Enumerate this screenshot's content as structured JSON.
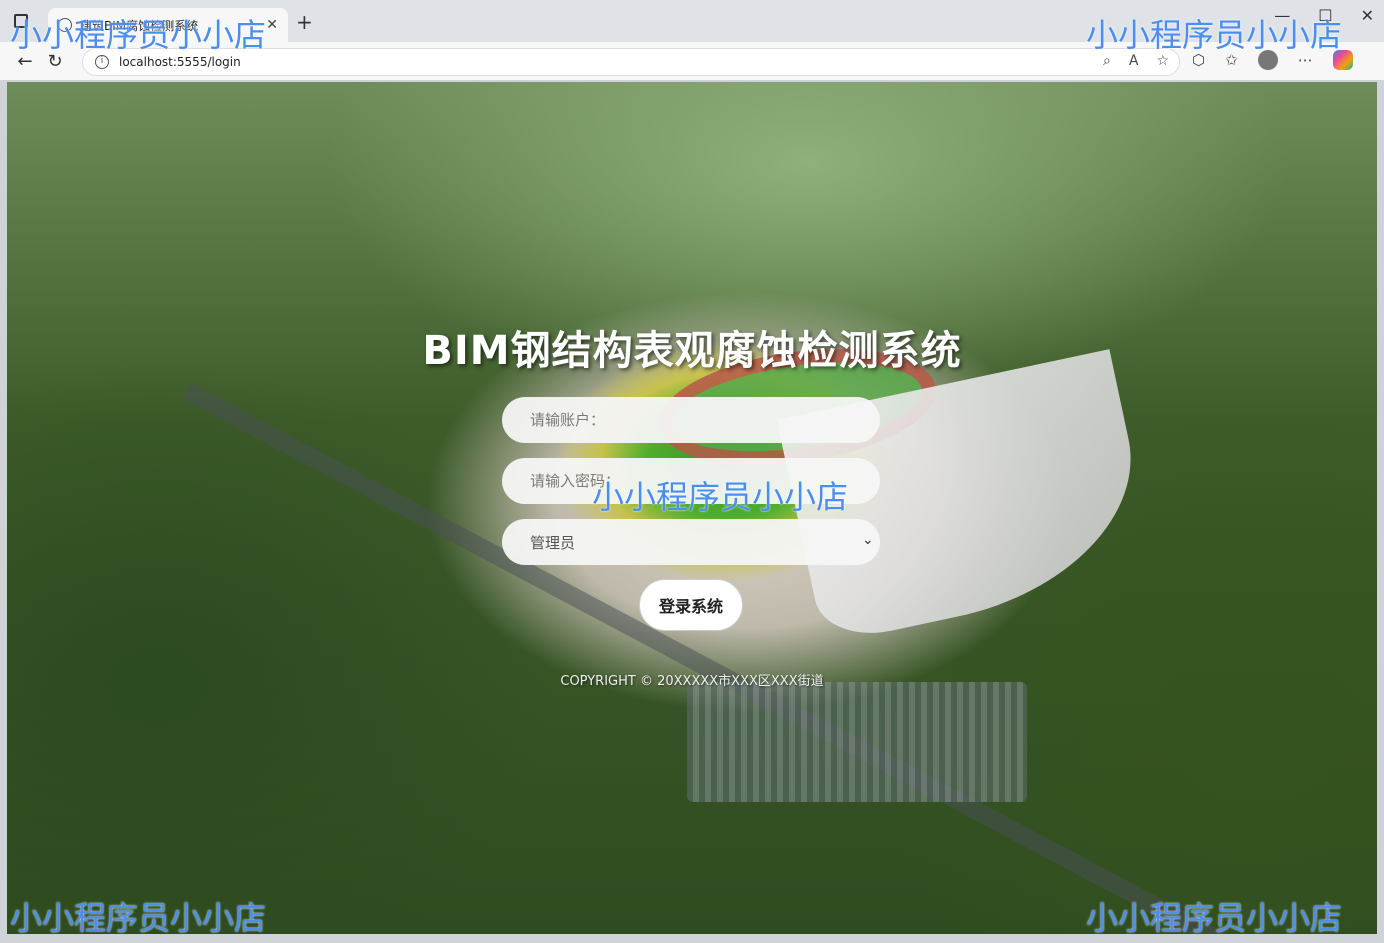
{
  "browser": {
    "tab_title": "建筑BIM腐蚀检测系统",
    "tab_close": "✕",
    "new_tab": "+",
    "url": "localhost:5555/login",
    "window_controls": [
      "—",
      "☐",
      "✕"
    ]
  },
  "login": {
    "title": "BIM钢结构表观腐蚀检测系统",
    "username_placeholder": "请输账户：",
    "password_placeholder": "请输入密码：",
    "role_selected": "管理员",
    "submit_label": "登录系统",
    "copyright": "COPYRIGHT © 20XXXXX市XXX区XXX街道"
  },
  "watermark": {
    "text": "小小程序员小小店"
  },
  "colors": {
    "watermark": "#4b8ef0",
    "title": "#ffffff"
  }
}
